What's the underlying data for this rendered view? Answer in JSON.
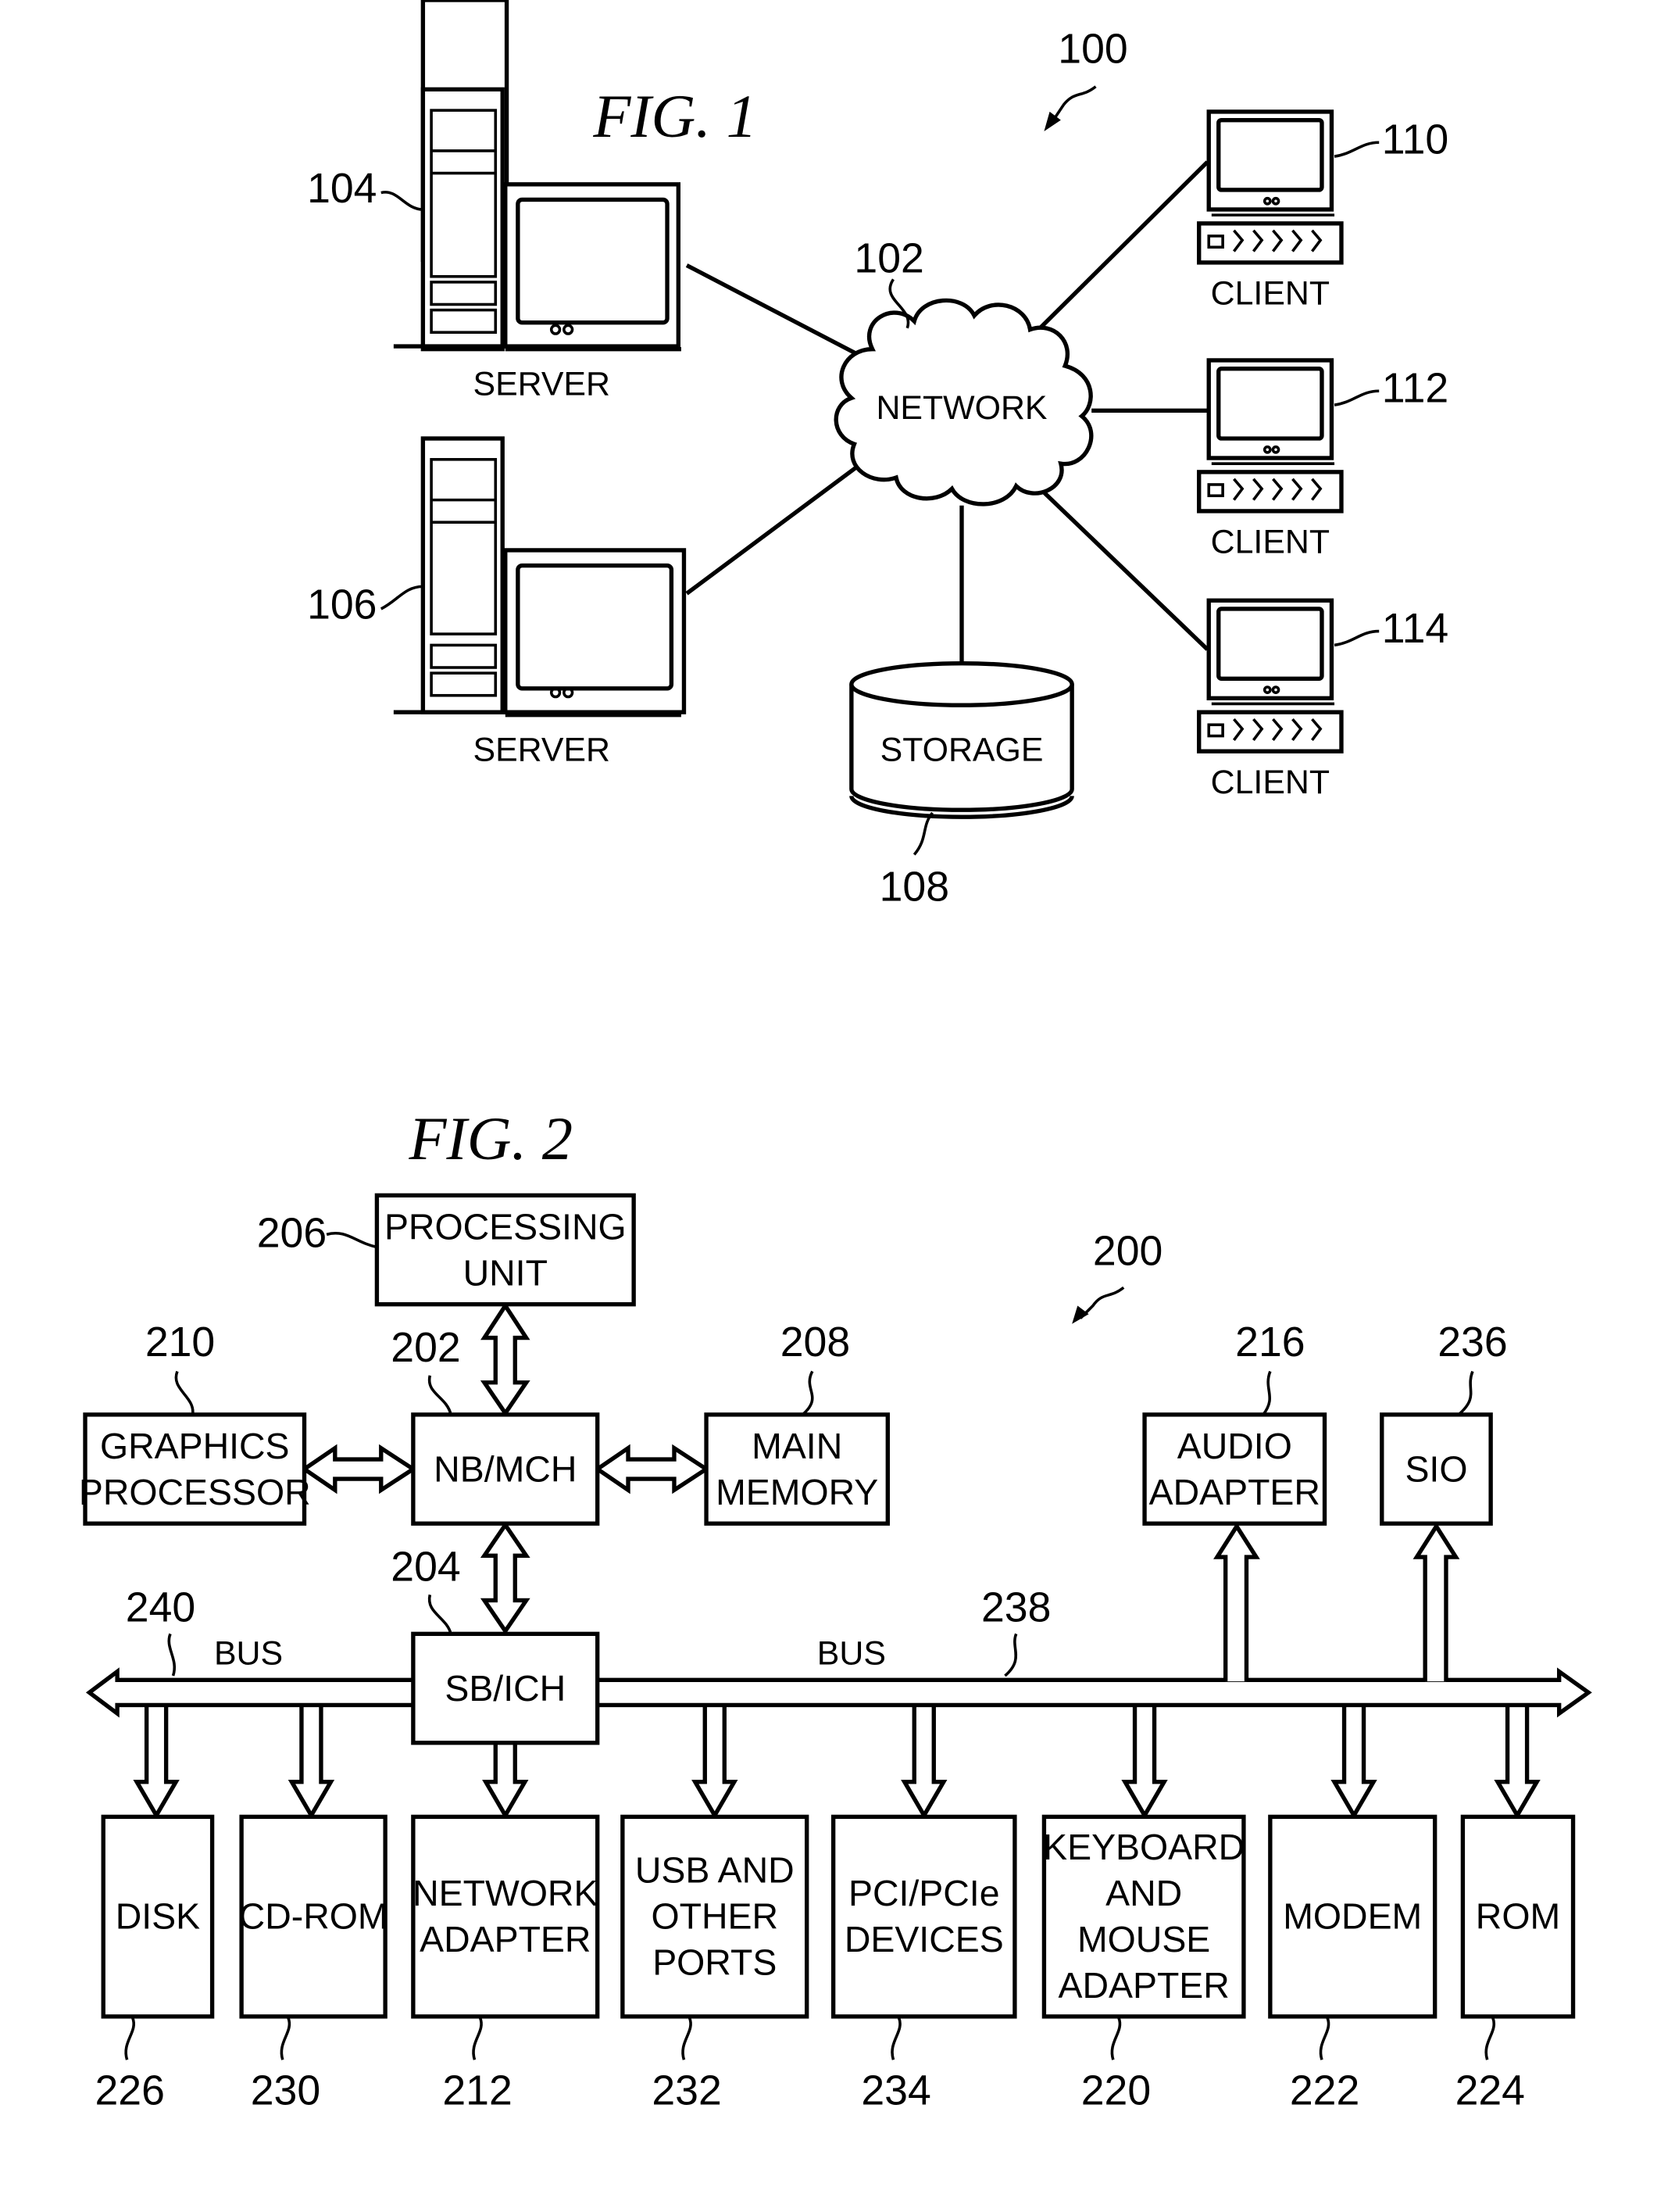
{
  "fig1": {
    "title": "FIG. 1",
    "system_ref": "100",
    "network": {
      "label": "NETWORK",
      "ref": "102"
    },
    "servers": [
      {
        "label": "SERVER",
        "ref": "104"
      },
      {
        "label": "SERVER",
        "ref": "106"
      }
    ],
    "storage": {
      "label": "STORAGE",
      "ref": "108"
    },
    "clients": [
      {
        "label": "CLIENT",
        "ref": "110"
      },
      {
        "label": "CLIENT",
        "ref": "112"
      },
      {
        "label": "CLIENT",
        "ref": "114"
      }
    ]
  },
  "fig2": {
    "title": "FIG. 2",
    "system_ref": "200",
    "processing_unit": {
      "lines": [
        "PROCESSING",
        "UNIT"
      ],
      "ref": "206"
    },
    "graphics_processor": {
      "lines": [
        "GRAPHICS",
        "PROCESSOR"
      ],
      "ref": "210"
    },
    "nb_mch": {
      "lines": [
        "NB/MCH"
      ],
      "ref": "202"
    },
    "main_memory": {
      "lines": [
        "MAIN",
        "MEMORY"
      ],
      "ref": "208"
    },
    "audio_adapter": {
      "lines": [
        "AUDIO",
        "ADAPTER"
      ],
      "ref": "216"
    },
    "sio": {
      "lines": [
        "SIO"
      ],
      "ref": "236"
    },
    "sb_ich": {
      "lines": [
        "SB/ICH"
      ],
      "ref": "204"
    },
    "bus_left": {
      "label": "BUS",
      "ref": "240"
    },
    "bus_right": {
      "label": "BUS",
      "ref": "238"
    },
    "devices": [
      {
        "id": "disk",
        "lines": [
          "DISK"
        ],
        "ref": "226"
      },
      {
        "id": "cd-rom",
        "lines": [
          "CD-ROM"
        ],
        "ref": "230"
      },
      {
        "id": "network-adapter",
        "lines": [
          "NETWORK",
          "ADAPTER"
        ],
        "ref": "212"
      },
      {
        "id": "usb-ports",
        "lines": [
          "USB AND",
          "OTHER",
          "PORTS"
        ],
        "ref": "232"
      },
      {
        "id": "pci-devices",
        "lines": [
          "PCI/PCIe",
          "DEVICES"
        ],
        "ref": "234"
      },
      {
        "id": "keyboard-mouse-adapter",
        "lines": [
          "KEYBOARD",
          "AND",
          "MOUSE",
          "ADAPTER"
        ],
        "ref": "220"
      },
      {
        "id": "modem",
        "lines": [
          "MODEM"
        ],
        "ref": "222"
      },
      {
        "id": "rom",
        "lines": [
          "ROM"
        ],
        "ref": "224"
      }
    ]
  }
}
